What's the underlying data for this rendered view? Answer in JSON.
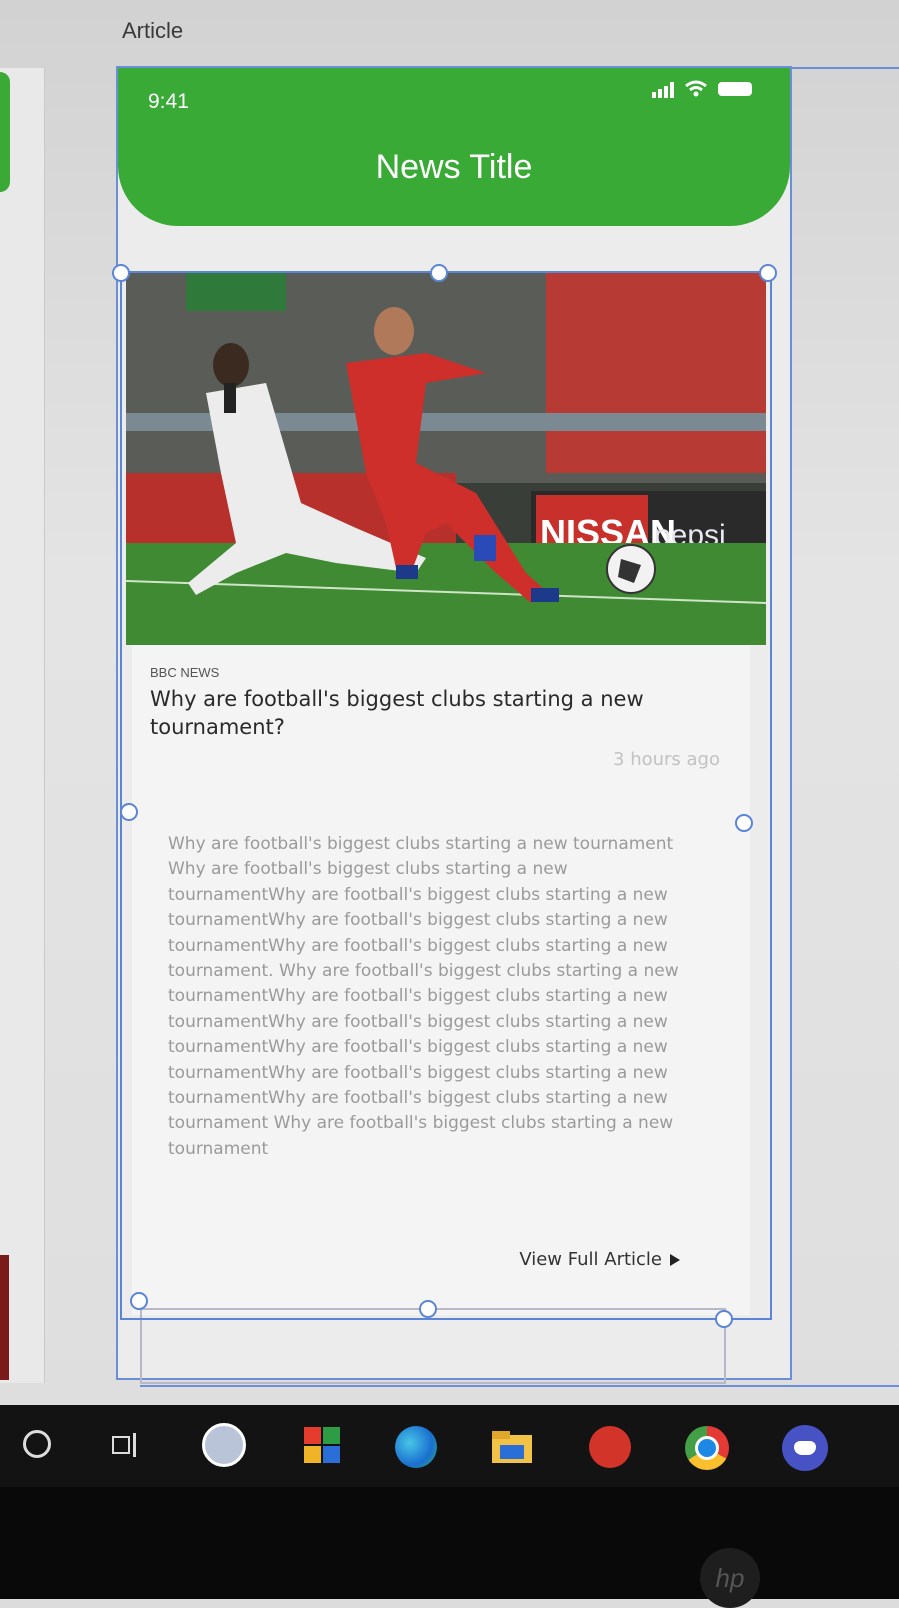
{
  "artboard": {
    "label": "Article"
  },
  "status_bar": {
    "time": "9:41"
  },
  "header": {
    "title": "News Title"
  },
  "hero": {
    "ad_board_1": "NISSAN",
    "ad_board_2": "pepsi"
  },
  "article": {
    "source": "BBC NEWS",
    "headline": "Why are football's biggest clubs starting a new tournament?",
    "timestamp": "3 hours ago",
    "body": "Why are football's biggest clubs starting a new tournament Why are football's biggest clubs starting a new tournamentWhy are football's biggest clubs starting a new tournamentWhy are football's biggest clubs starting a new tournamentWhy are football's biggest clubs starting a new tournament. Why are football's biggest clubs starting a new tournamentWhy are football's biggest clubs starting a new tournamentWhy are football's biggest clubs starting a new tournamentWhy are football's biggest clubs starting a new tournamentWhy are football's biggest clubs starting a new tournamentWhy are football's biggest clubs starting a new tournament Why are football's biggest clubs starting a new tournament",
    "cta": "View Full Article"
  },
  "colors": {
    "header_green": "#3aaa37",
    "selection_blue": "#5b85d6"
  },
  "taskbar": {
    "items": [
      "start-circle-icon",
      "task-view-icon",
      "app-circle-icon",
      "colorful-tiles-icon",
      "edge-browser-icon",
      "file-explorer-icon",
      "red-app-icon",
      "chrome-icon",
      "discord-icon"
    ]
  },
  "device_logo": "hp"
}
